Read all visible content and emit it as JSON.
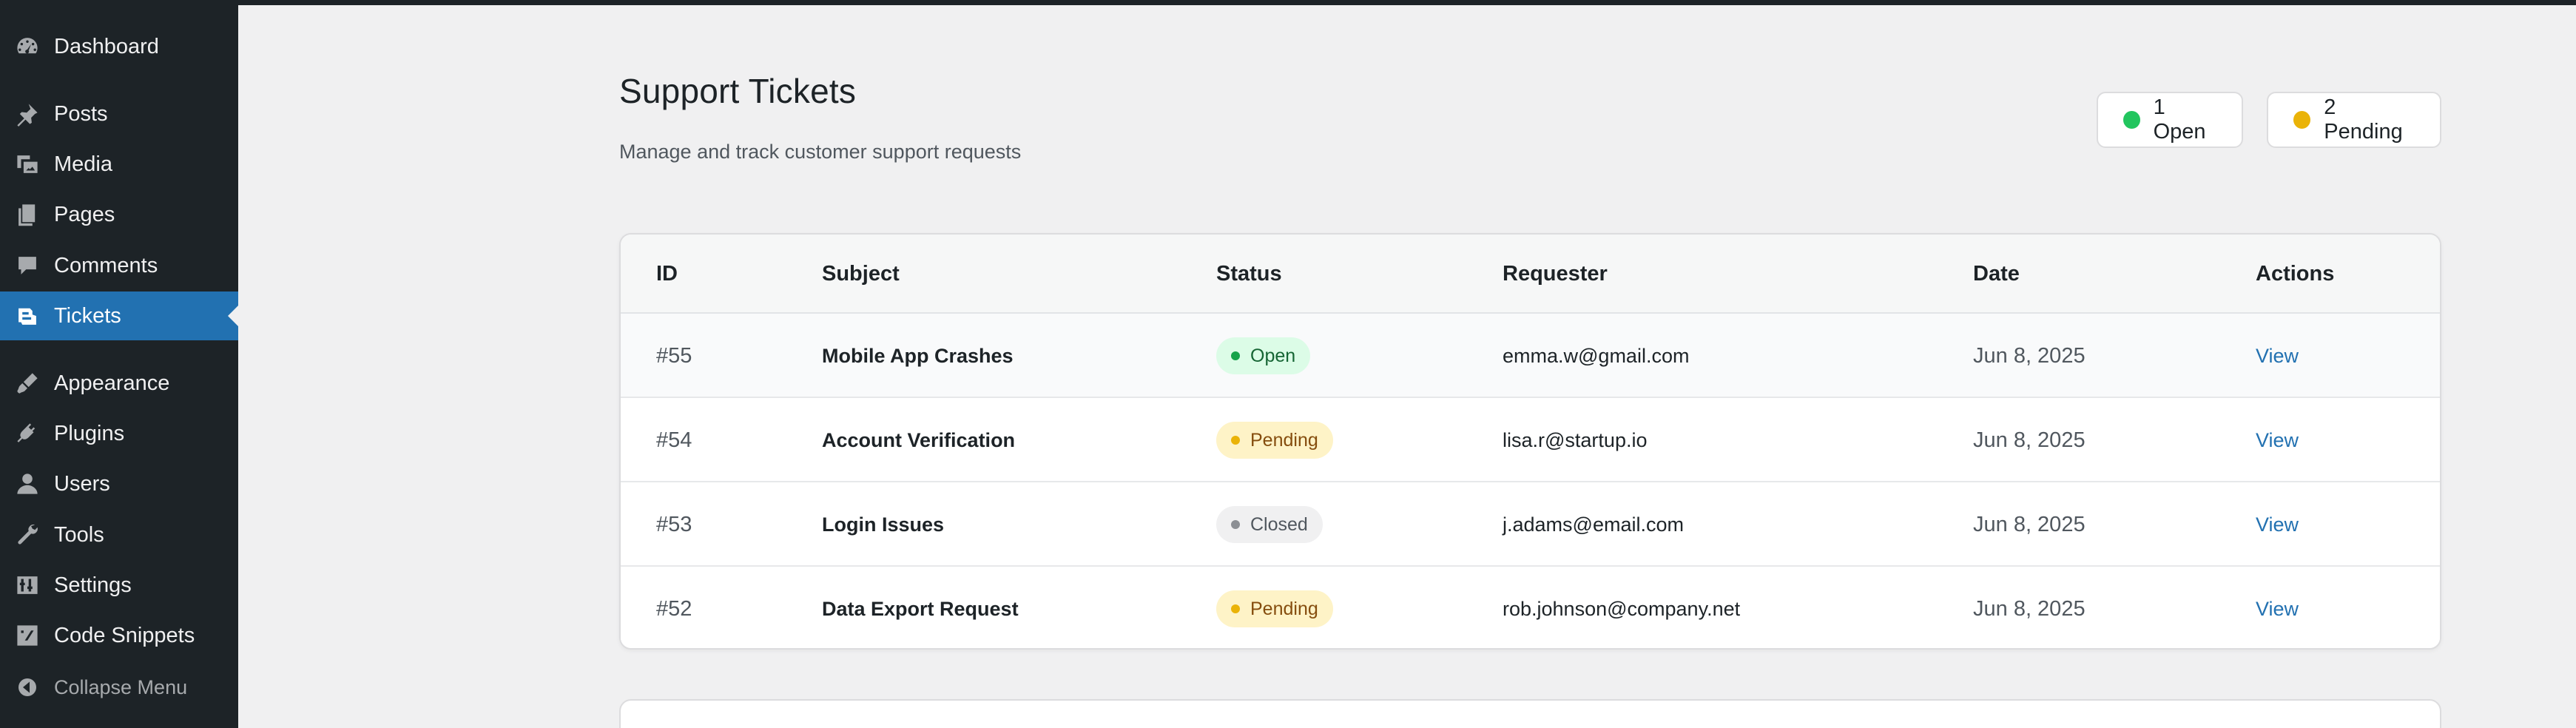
{
  "sidebar": {
    "items": [
      {
        "label": "Dashboard",
        "icon": "dashboard-icon"
      },
      {
        "label": "Posts",
        "icon": "pin-icon"
      },
      {
        "label": "Media",
        "icon": "media-icon"
      },
      {
        "label": "Pages",
        "icon": "pages-icon"
      },
      {
        "label": "Comments",
        "icon": "comment-icon"
      },
      {
        "label": "Tickets",
        "icon": "tickets-icon",
        "active": true
      },
      {
        "label": "Appearance",
        "icon": "brush-icon"
      },
      {
        "label": "Plugins",
        "icon": "plug-icon"
      },
      {
        "label": "Users",
        "icon": "user-icon"
      },
      {
        "label": "Tools",
        "icon": "wrench-icon"
      },
      {
        "label": "Settings",
        "icon": "settings-icon"
      },
      {
        "label": "Code Snippets",
        "icon": "code-icon"
      }
    ],
    "collapse_label": "Collapse Menu"
  },
  "header": {
    "title": "Support Tickets",
    "subtitle": "Manage and track customer support requests"
  },
  "summary": {
    "open_label": "1 Open",
    "pending_label": "2 Pending",
    "open_color": "#22c55e",
    "pending_color": "#eab308"
  },
  "table": {
    "columns": [
      "ID",
      "Subject",
      "Status",
      "Requester",
      "Date",
      "Actions"
    ],
    "rows": [
      {
        "id": "#55",
        "subject": "Mobile App Crashes",
        "status": "Open",
        "requester": "emma.w@gmail.com",
        "date": "Jun 8, 2025",
        "action": "View"
      },
      {
        "id": "#54",
        "subject": "Account Verification",
        "status": "Pending",
        "requester": "lisa.r@startup.io",
        "date": "Jun 8, 2025",
        "action": "View"
      },
      {
        "id": "#53",
        "subject": "Login Issues",
        "status": "Closed",
        "requester": "j.adams@email.com",
        "date": "Jun 8, 2025",
        "action": "View"
      },
      {
        "id": "#52",
        "subject": "Data Export Request",
        "status": "Pending",
        "requester": "rob.johnson@company.net",
        "date": "Jun 8, 2025",
        "action": "View"
      }
    ]
  },
  "colors": {
    "sidebar_bg": "#1d2327",
    "accent": "#2271b1",
    "page_bg": "#f0f0f1"
  }
}
